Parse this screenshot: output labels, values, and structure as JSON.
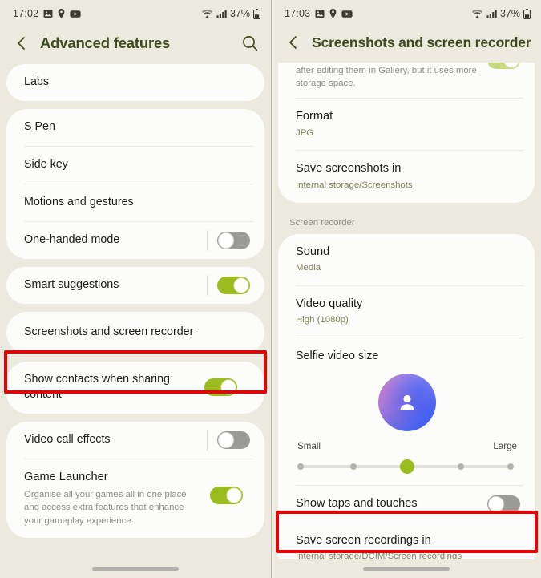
{
  "left": {
    "status_bar": {
      "time": "17:02",
      "left_icons": [
        "image-icon",
        "location-pin-icon",
        "youtube-icon"
      ],
      "right_icons": [
        "wifi-icon",
        "signal-icon",
        "battery-icon"
      ],
      "battery": "37%"
    },
    "title": "Advanced features",
    "back_label": "Back",
    "search_label": "Search",
    "cards": [
      {
        "rows": [
          {
            "title": "Labs",
            "type": "nav"
          }
        ]
      },
      {
        "rows": [
          {
            "title": "S Pen",
            "type": "nav"
          },
          {
            "title": "Side key",
            "type": "nav"
          },
          {
            "title": "Motions and gestures",
            "type": "nav"
          },
          {
            "title": "One-handed mode",
            "type": "toggle",
            "toggle": "off"
          }
        ]
      },
      {
        "rows": [
          {
            "title": "Smart suggestions",
            "type": "toggle",
            "toggle": "on"
          }
        ]
      },
      {
        "highlighted": true,
        "rows": [
          {
            "title": "Screenshots and screen recorder",
            "type": "nav"
          }
        ]
      },
      {
        "rows": [
          {
            "title": "Show contacts when sharing content",
            "type": "toggle",
            "toggle": "on"
          }
        ]
      },
      {
        "rows": [
          {
            "title": "Video call effects",
            "type": "toggle",
            "toggle": "off"
          },
          {
            "title": "Game Launcher",
            "desc": "Organise all your games all in one place and access extra features that enhance your gameplay experience.",
            "type": "toggle",
            "toggle": "on"
          }
        ]
      }
    ]
  },
  "right": {
    "status_bar": {
      "time": "17:03",
      "left_icons": [
        "image-icon",
        "location-pin-icon",
        "youtube-icon"
      ],
      "right_icons": [
        "wifi-icon",
        "signal-icon",
        "battery-icon"
      ],
      "battery": "37%"
    },
    "title": "Screenshots and screen recorder",
    "back_label": "Back",
    "clipped_row": {
      "desc": "after editing them in Gallery, but it uses more storage space.",
      "toggle": "on"
    },
    "screenshot_rows": [
      {
        "title": "Format",
        "sub": "JPG"
      },
      {
        "title": "Save screenshots in",
        "sub": "Internal storage/Screenshots"
      }
    ],
    "section_label": "Screen recorder",
    "recorder_rows": [
      {
        "title": "Sound",
        "sub": "Media"
      },
      {
        "title": "Video quality",
        "sub": "High (1080p)"
      }
    ],
    "selfie": {
      "title": "Selfie video size",
      "avatar_icon": "person-icon",
      "min_label": "Small",
      "max_label": "Large",
      "steps": 5,
      "value": 3
    },
    "taps_row": {
      "title": "Show taps and touches",
      "toggle": "off"
    },
    "save_recordings_row": {
      "title": "Save screen recordings in",
      "sub": "Internal storage/DCIM/Screen recordings",
      "highlighted": true
    }
  },
  "colors": {
    "accent_green": "#9cbb1e",
    "title_green": "#3f4a1f",
    "sub_olive": "#7c7f55",
    "highlight_red": "#ef0000",
    "page_bg": "#eceade",
    "card_bg": "#fcfcfa"
  }
}
